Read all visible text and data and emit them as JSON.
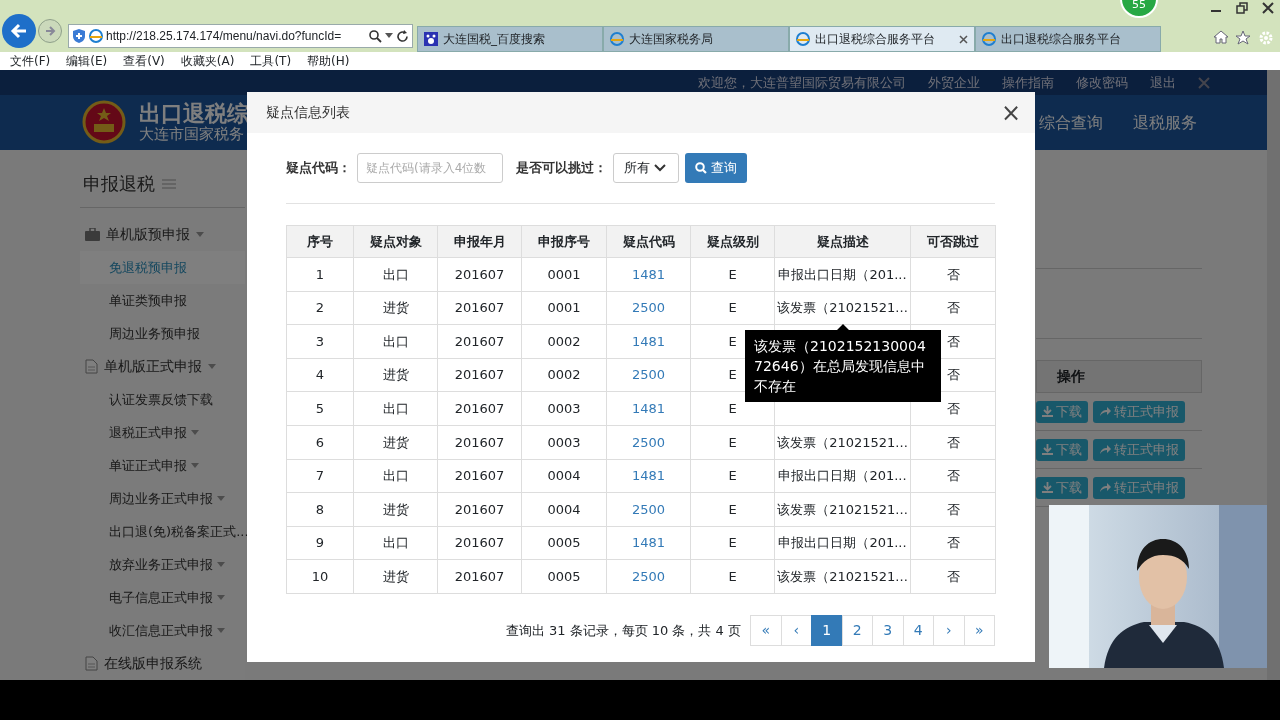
{
  "browser": {
    "badge": "55",
    "address": "http://218.25.174.174/menu/navi.do?funcId=",
    "tabs": [
      {
        "label": "大连国税_百度搜索",
        "kind": "paw",
        "selected": false
      },
      {
        "label": "大连国家税务局",
        "kind": "globe",
        "selected": false
      },
      {
        "label": "出口退税综合服务平台",
        "kind": "globe",
        "selected": true
      },
      {
        "label": "出口退税综合服务平台",
        "kind": "globe",
        "selected": false
      }
    ],
    "menu": [
      "文件(F)",
      "编辑(E)",
      "查看(V)",
      "收藏夹(A)",
      "工具(T)",
      "帮助(H)"
    ]
  },
  "site": {
    "welcome": [
      "欢迎您，大连普望国际贸易有限公司",
      "外贸企业",
      "操作指南",
      "修改密码",
      "退出"
    ],
    "title": "出口退税综",
    "subtitle": "大连市国家税务",
    "nav": [
      "综合查询",
      "退税服务"
    ],
    "sidebar": {
      "title": "申报退税",
      "groups": [
        {
          "label": "单机版预申报",
          "kind": "briefcase",
          "submenu": true,
          "children": [
            {
              "label": "免退税预申报",
              "selected": true,
              "submenu": false
            },
            {
              "label": "单证类预申报",
              "selected": false,
              "submenu": false
            },
            {
              "label": "周边业务预申报",
              "selected": false,
              "submenu": false
            }
          ]
        },
        {
          "label": "单机版正式申报",
          "kind": "document",
          "submenu": true,
          "children": [
            {
              "label": "认证发票反馈下载",
              "selected": false,
              "submenu": false
            },
            {
              "label": "退税正式申报",
              "selected": false,
              "submenu": true
            },
            {
              "label": "单证正式申报",
              "selected": false,
              "submenu": true
            },
            {
              "label": "周边业务正式申报",
              "selected": false,
              "submenu": true
            },
            {
              "label": "出口退(免)税备案正式...",
              "selected": false,
              "submenu": false
            },
            {
              "label": "放弃业务正式申报",
              "selected": false,
              "submenu": true
            },
            {
              "label": "电子信息正式申报",
              "selected": false,
              "submenu": true
            },
            {
              "label": "收汇信息正式申报",
              "selected": false,
              "submenu": true
            }
          ]
        },
        {
          "label": "在线版申报系统",
          "kind": "document",
          "submenu": false
        }
      ]
    },
    "panel": {
      "column": "操作",
      "rows": [
        {
          "download": "下载",
          "convert": "转正式申报"
        },
        {
          "download": "下载",
          "convert": "转正式申报"
        },
        {
          "download": "下载",
          "convert": "转正式申报"
        }
      ]
    }
  },
  "modal": {
    "title": "疑点信息列表",
    "close": "×",
    "code_filter": {
      "label": "疑点代码：",
      "placeholder": "疑点代码(请录入4位数"
    },
    "skip_filter": {
      "label": "是否可以挑过：",
      "value": "所有"
    },
    "search_button": "查询",
    "table": {
      "columns": [
        {
          "label": "序号",
          "kind": "text"
        },
        {
          "label": "疑点对象",
          "kind": "text"
        },
        {
          "label": "申报年月",
          "kind": "text"
        },
        {
          "label": "申报序号",
          "kind": "text"
        },
        {
          "label": "疑点代码",
          "kind": "link"
        },
        {
          "label": "疑点级别",
          "kind": "text"
        },
        {
          "label": "疑点描述",
          "kind": "text"
        },
        {
          "label": "可否跳过",
          "kind": "text"
        }
      ],
      "rows": [
        [
          "1",
          "出口",
          "201607",
          "0001",
          "1481",
          "E",
          "申报出口日期（201...",
          "否"
        ],
        [
          "2",
          "进货",
          "201607",
          "0001",
          "2500",
          "E",
          "该发票（21021521...",
          "否"
        ],
        [
          "3",
          "出口",
          "201607",
          "0002",
          "1481",
          "E",
          "",
          "否"
        ],
        [
          "4",
          "进货",
          "201607",
          "0002",
          "2500",
          "E",
          "",
          "否"
        ],
        [
          "5",
          "出口",
          "201607",
          "0003",
          "1481",
          "E",
          "",
          "否"
        ],
        [
          "6",
          "进货",
          "201607",
          "0003",
          "2500",
          "E",
          "该发票（21021521...",
          "否"
        ],
        [
          "7",
          "出口",
          "201607",
          "0004",
          "1481",
          "E",
          "申报出口日期（201...",
          "否"
        ],
        [
          "8",
          "进货",
          "201607",
          "0004",
          "2500",
          "E",
          "该发票（21021521...",
          "否"
        ],
        [
          "9",
          "出口",
          "201607",
          "0005",
          "1481",
          "E",
          "申报出口日期（201...",
          "否"
        ],
        [
          "10",
          "进货",
          "201607",
          "0005",
          "2500",
          "E",
          "该发票（21021521...",
          "否"
        ]
      ]
    },
    "summary": "查询出 31 条记录，每页 10 条，共 4 页",
    "pagination": [
      {
        "label": "«",
        "selected": false
      },
      {
        "label": "‹",
        "selected": false
      },
      {
        "label": "1",
        "selected": true
      },
      {
        "label": "2",
        "selected": false
      },
      {
        "label": "3",
        "selected": false
      },
      {
        "label": "4",
        "selected": false
      },
      {
        "label": "›",
        "selected": false
      },
      {
        "label": "»",
        "selected": false
      }
    ]
  },
  "tooltip": {
    "text": "该发票（210215213000472646）在总局发现信息中不存在"
  }
}
